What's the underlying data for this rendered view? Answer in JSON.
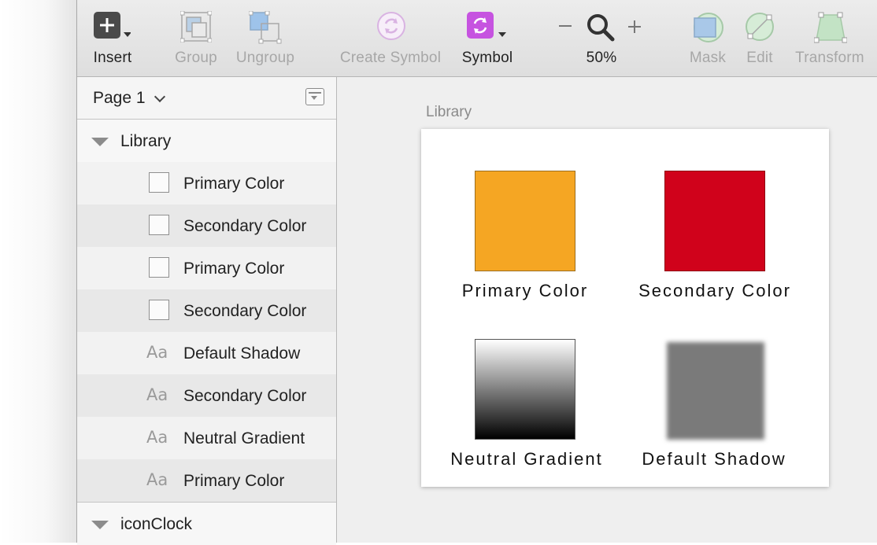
{
  "toolbar": {
    "insert": "Insert",
    "group": "Group",
    "ungroup": "Ungroup",
    "create_symbol": "Create Symbol",
    "symbol": "Symbol",
    "zoom": "50%",
    "mask": "Mask",
    "edit": "Edit",
    "transform": "Transform"
  },
  "sidebar": {
    "page_title": "Page 1",
    "groups": [
      {
        "name": "Library",
        "layers": [
          {
            "type": "swatch",
            "label": "Primary Color"
          },
          {
            "type": "swatch",
            "label": "Secondary Color"
          },
          {
            "type": "swatch",
            "label": "Primary Color"
          },
          {
            "type": "swatch",
            "label": "Secondary Color"
          },
          {
            "type": "text",
            "icon_text": "Aa",
            "label": "Default Shadow"
          },
          {
            "type": "text",
            "icon_text": "Aa",
            "label": "Secondary Color"
          },
          {
            "type": "text",
            "icon_text": "Aa",
            "label": "Neutral Gradient"
          },
          {
            "type": "text",
            "icon_text": "Aa",
            "label": "Primary Color"
          }
        ]
      },
      {
        "name": "iconClock"
      }
    ]
  },
  "canvas": {
    "artboard_title": "Library",
    "swatches": [
      {
        "label": "Primary Color",
        "color": "#f5a623"
      },
      {
        "label": "Secondary Color",
        "color": "#d0021b"
      },
      {
        "label": "Neutral Gradient",
        "from": "#ffffff",
        "to": "#000000"
      },
      {
        "label": "Default Shadow",
        "color": "#7a7a7a"
      }
    ]
  },
  "colors": {
    "symbol_accent": "#c653e0",
    "insert_bg": "#4a4a4a"
  }
}
